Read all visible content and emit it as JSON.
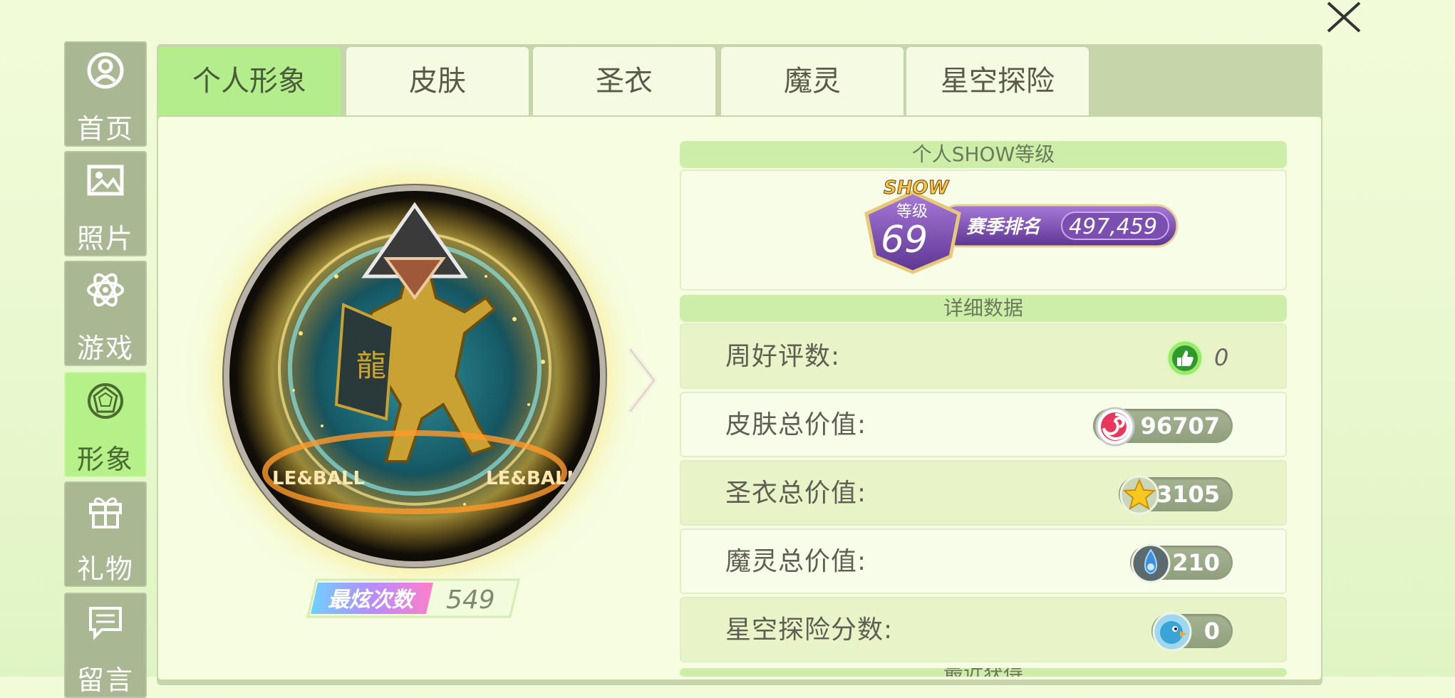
{
  "sidebar": {
    "items": [
      {
        "label": "首页",
        "icon": "user-icon"
      },
      {
        "label": "照片",
        "icon": "photo-icon"
      },
      {
        "label": "游戏",
        "icon": "atom-icon"
      },
      {
        "label": "形象",
        "icon": "gem-icon",
        "active": true
      },
      {
        "label": "礼物",
        "icon": "gift-icon"
      },
      {
        "label": "留言",
        "icon": "message-icon"
      }
    ]
  },
  "tabs": [
    {
      "label": "个人形象",
      "active": true
    },
    {
      "label": "皮肤"
    },
    {
      "label": "圣衣"
    },
    {
      "label": "魔灵"
    },
    {
      "label": "星空探险"
    }
  ],
  "profile": {
    "count_label": "最炫次数",
    "count_value": "549",
    "portrait_ring_text": "LE&BALL"
  },
  "show_level": {
    "section_title": "个人SHOW等级",
    "badge_word": "SHOW",
    "badge_sub": "等级",
    "level": "69",
    "rank_label": "赛季排名",
    "rank_value": "497,459"
  },
  "details": {
    "section_title": "详细数据",
    "rows": [
      {
        "label": "周好评数:",
        "value": "0",
        "icon": "thumbs-up-icon"
      },
      {
        "label": "皮肤总价值:",
        "value": "96707",
        "icon": "candy-icon"
      },
      {
        "label": "圣衣总价值:",
        "value": "3105",
        "icon": "star-icon"
      },
      {
        "label": "魔灵总价值:",
        "value": "210",
        "icon": "spirit-icon"
      },
      {
        "label": "星空探险分数:",
        "value": "0",
        "icon": "bird-icon"
      }
    ]
  },
  "next_section_title": "最近获得",
  "colors": {
    "tab_active": "#b4ee8c",
    "sidebar_active": "#b6f089",
    "sidebar_item": "#a9b893",
    "section_head": "#cdeea8",
    "badge_purple": "#7b4fb0"
  }
}
